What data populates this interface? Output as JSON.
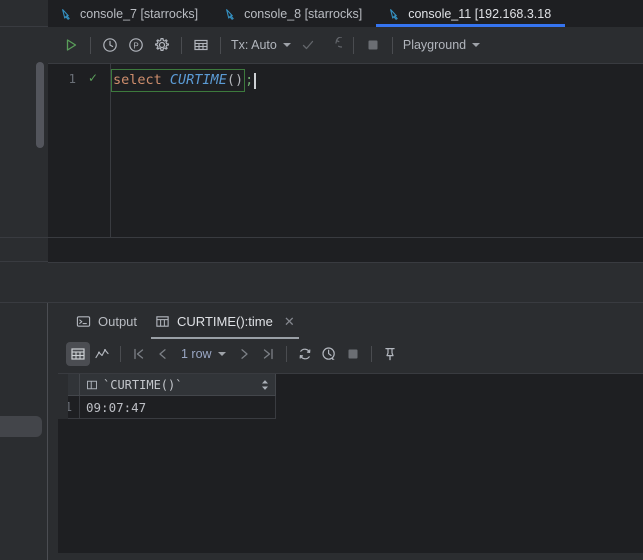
{
  "window": {
    "theme_bg": "#2b2d30",
    "editor_bg": "#1e1f22",
    "accent": "#3574f0"
  },
  "tabs": [
    {
      "label": "console_7 [starrocks]",
      "icon": "console-icon",
      "active": false
    },
    {
      "label": "console_8 [starrocks]",
      "icon": "console-icon",
      "active": false
    },
    {
      "label": "console_11 [192.168.3.18",
      "icon": "console-icon",
      "active": true
    }
  ],
  "editor_toolbar": {
    "execute": "execute-icon",
    "history": "history-icon",
    "profile": "profile-icon",
    "settings": "settings-icon",
    "grid": "data-grid-icon",
    "tx_label": "Tx: Auto",
    "commit": "commit-icon",
    "rollback": "rollback-icon",
    "stop": "stop-icon",
    "schema_label": "Playground"
  },
  "editor": {
    "line_number": "1",
    "inspection_status": "✓",
    "code": {
      "keyword": "select",
      "space": " ",
      "function": "CURTIME",
      "parens": "()",
      "semicolon": ";"
    }
  },
  "results": {
    "tabs": [
      {
        "label": "Output",
        "icon": "terminal-icon",
        "active": false,
        "closable": false
      },
      {
        "label": "CURTIME():time",
        "icon": "table-icon",
        "active": true,
        "closable": true,
        "close_glyph": "✕"
      }
    ],
    "toolbar": {
      "grid_view": "table-view-icon",
      "chart_view": "chart-view-icon",
      "first_page": "first-page-icon",
      "prev_page": "prev-page-icon",
      "row_count": "1 row",
      "next_page": "next-page-icon",
      "last_page": "last-page-icon",
      "reload": "reload-icon",
      "timing": "timing-icon",
      "stop": "stop-icon",
      "pin": "pin-icon"
    },
    "grid": {
      "columns": [
        "`CURTIME()`"
      ],
      "rows": [
        {
          "num": "1",
          "values": [
            "09:07:47"
          ]
        }
      ]
    }
  }
}
